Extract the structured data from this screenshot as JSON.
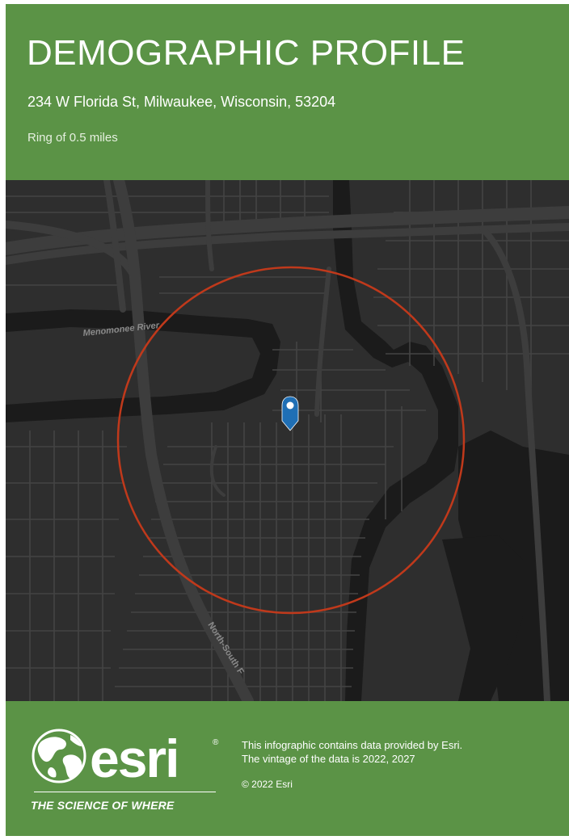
{
  "header": {
    "title": "DEMOGRAPHIC PROFILE",
    "address": "234 W Florida St, Milwaukee, Wisconsin, 53204",
    "ring": "Ring of 0.5 miles"
  },
  "map": {
    "labels": {
      "river": "Menomonee River",
      "highway": "North-South F"
    },
    "colors": {
      "land": "#2e2e2e",
      "water": "#1c1c1c",
      "road": "#474747",
      "ring": "#c0391b",
      "marker": "#1f6fb5"
    },
    "marker_icon": "location-pin-icon"
  },
  "footer": {
    "logo_text": "esri",
    "logo_icon": "globe-icon",
    "tagline": "THE SCIENCE OF WHERE",
    "footnote_line1": "This infographic contains data provided by Esri.",
    "footnote_line2": "The vintage of the data is 2022, 2027",
    "copyright": "© 2022 Esri"
  },
  "colors": {
    "brand_green": "#5b9346"
  }
}
